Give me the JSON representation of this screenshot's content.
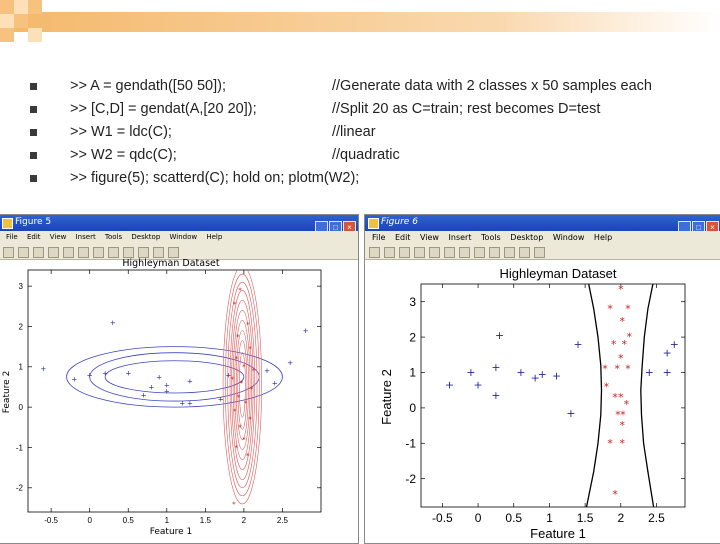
{
  "commands": [
    {
      "code": ">> A = gendath([50 50]);",
      "comment": "//Generate data with 2 classes x 50 samples each"
    },
    {
      "code": ">> [C,D] = gendat(A,[20 20]);",
      "comment": "//Split 20 as C=train; rest becomes D=test"
    },
    {
      "code": ">> W1 = ldc(C);",
      "comment": "//linear"
    },
    {
      "code": ">> W2 = qdc(C);",
      "comment": "//quadratic"
    },
    {
      "code": ">> figure(5); scatterd(C); hold on; plotm(W2);",
      "comment": ""
    }
  ],
  "colors": {
    "class1": "#22289a",
    "class2": "#c81e1e",
    "contour": "#e05a5a",
    "ellipse": "#3c45c0",
    "boundary": "#000000",
    "titlebar": "#1f4fc0"
  },
  "left_figure": {
    "window_title": "Figure 5",
    "menu": [
      "File",
      "Edit",
      "View",
      "Insert",
      "Tools",
      "Desktop",
      "Window",
      "Help"
    ],
    "toolbar_icons": [
      "new-icon",
      "open-icon",
      "save-icon",
      "print-icon",
      "pointer-icon",
      "zoom-in-icon",
      "zoom-out-icon",
      "pan-icon",
      "rotate-icon",
      "datacursor-icon",
      "colorbar-icon",
      "legend-icon"
    ]
  },
  "right_figure": {
    "window_title": "Figure 6",
    "menu": [
      "File",
      "Edit",
      "View",
      "Insert",
      "Tools",
      "Desktop",
      "Window",
      "Help"
    ],
    "toolbar_icons": [
      "new-icon",
      "open-icon",
      "save-icon",
      "print-icon",
      "pointer-icon",
      "zoom-in-icon",
      "zoom-out-icon",
      "pan-icon",
      "rotate-icon",
      "datacursor-icon",
      "colorbar-icon",
      "legend-icon"
    ]
  },
  "chart_data": [
    {
      "type": "scatter",
      "title": "Highleyman Dataset",
      "xlabel": "Feature 1",
      "ylabel": "Feature 2",
      "xlim": [
        -0.8,
        3.0
      ],
      "ylim": [
        -2.6,
        3.4
      ],
      "xticks": [
        -0.5,
        0,
        0.5,
        1,
        1.5,
        2,
        2.5
      ],
      "yticks": [
        -2,
        -1,
        0,
        1,
        2,
        3
      ],
      "xtick_labels": [
        "-0.5",
        "0",
        "0.5",
        "1",
        "1.5",
        "2",
        "2.5"
      ],
      "ytick_labels": [
        "-2",
        "-1",
        "0",
        "1",
        "2",
        "3"
      ],
      "series": [
        {
          "marker": "+",
          "color": "#22289a",
          "points": [
            [
              0.3,
              2.1
            ],
            [
              -0.6,
              0.95
            ],
            [
              2.8,
              1.9
            ],
            [
              2.6,
              1.1
            ],
            [
              0.9,
              0.75
            ],
            [
              0.8,
              0.5
            ],
            [
              1.7,
              0.2
            ],
            [
              0.5,
              0.85
            ],
            [
              2.3,
              0.9
            ],
            [
              -0.2,
              0.7
            ],
            [
              0.0,
              0.8
            ],
            [
              0.7,
              0.3
            ],
            [
              1.3,
              0.65
            ],
            [
              1.0,
              0.4
            ],
            [
              1.2,
              0.1
            ],
            [
              1.3,
              0.1
            ],
            [
              2.4,
              0.6
            ],
            [
              0.2,
              0.85
            ],
            [
              1.8,
              0.8
            ],
            [
              1.0,
              0.55
            ]
          ]
        },
        {
          "marker": "*",
          "color": "#c81e1e",
          "points": [
            [
              1.95,
              2.9
            ],
            [
              1.88,
              2.55
            ],
            [
              2.05,
              2.05
            ],
            [
              1.92,
              1.75
            ],
            [
              2.08,
              1.45
            ],
            [
              1.9,
              1.2
            ],
            [
              2.0,
              1.0
            ],
            [
              2.12,
              0.9
            ],
            [
              1.85,
              0.7
            ],
            [
              1.97,
              0.6
            ],
            [
              2.1,
              0.45
            ],
            [
              1.93,
              0.25
            ],
            [
              2.02,
              0.1
            ],
            [
              1.88,
              -0.1
            ],
            [
              2.08,
              -0.3
            ],
            [
              1.95,
              -0.5
            ],
            [
              2.0,
              -0.8
            ],
            [
              1.9,
              -1.0
            ],
            [
              2.05,
              -1.2
            ],
            [
              1.87,
              -2.4
            ]
          ]
        }
      ],
      "ellipse_center": [
        1.1,
        0.75
      ],
      "ellipse_semi_axes": [
        [
          1.4,
          0.75
        ],
        [
          1.1,
          0.6
        ],
        [
          0.9,
          0.4
        ]
      ],
      "contour_center": [
        1.98,
        0.55
      ],
      "contour_semi_axes": [
        [
          0.04,
          0.8
        ],
        [
          0.06,
          1.1
        ],
        [
          0.08,
          1.35
        ],
        [
          0.1,
          1.6
        ],
        [
          0.12,
          1.85
        ],
        [
          0.14,
          2.1
        ],
        [
          0.16,
          2.35
        ],
        [
          0.19,
          2.55
        ],
        [
          0.22,
          2.75
        ],
        [
          0.25,
          2.95
        ]
      ]
    },
    {
      "type": "scatter",
      "title": "Highleyman Dataset",
      "xlabel": "Feature 1",
      "ylabel": "Feature 2",
      "xlim": [
        -0.8,
        2.9
      ],
      "ylim": [
        -2.8,
        3.5
      ],
      "xticks": [
        -0.5,
        0,
        0.5,
        1,
        1.5,
        2,
        2.5
      ],
      "yticks": [
        -2,
        -1,
        0,
        1,
        2,
        3
      ],
      "xtick_labels": [
        "-0.5",
        "0",
        "0.5",
        "1",
        "1.5",
        "2",
        "2.5"
      ],
      "ytick_labels": [
        "-2",
        "-1",
        "0",
        "1",
        "2",
        "3"
      ],
      "series": [
        {
          "marker": "+",
          "color": "#22289a",
          "points": [
            [
              0.3,
              2.05
            ],
            [
              -0.4,
              0.65
            ],
            [
              0.0,
              0.65
            ],
            [
              1.4,
              1.8
            ],
            [
              0.9,
              0.95
            ],
            [
              2.75,
              1.8
            ],
            [
              2.65,
              1.55
            ],
            [
              2.65,
              1.0
            ],
            [
              2.4,
              1.0
            ],
            [
              1.1,
              0.9
            ],
            [
              -0.1,
              1.0
            ],
            [
              0.6,
              1.0
            ],
            [
              0.25,
              0.35
            ],
            [
              0.8,
              0.85
            ],
            [
              1.3,
              -0.15
            ],
            [
              0.25,
              1.15
            ]
          ]
        },
        {
          "marker": "*",
          "color": "#c81e1e",
          "points": [
            [
              2.0,
              3.35
            ],
            [
              2.1,
              2.8
            ],
            [
              1.85,
              2.8
            ],
            [
              2.02,
              2.45
            ],
            [
              2.12,
              2.0
            ],
            [
              2.05,
              1.8
            ],
            [
              1.9,
              1.8
            ],
            [
              2.0,
              1.4
            ],
            [
              1.95,
              1.1
            ],
            [
              2.1,
              1.1
            ],
            [
              1.78,
              1.1
            ],
            [
              1.8,
              0.6
            ],
            [
              2.0,
              0.3
            ],
            [
              1.92,
              0.3
            ],
            [
              2.08,
              0.1
            ],
            [
              1.96,
              -0.2
            ],
            [
              2.03,
              -0.2
            ],
            [
              2.02,
              -0.5
            ],
            [
              1.85,
              -1.0
            ],
            [
              2.02,
              -1.0
            ],
            [
              1.92,
              -2.45
            ]
          ]
        }
      ],
      "boundary_left": [
        [
          1.55,
          3.5
        ],
        [
          1.62,
          2.8
        ],
        [
          1.68,
          2.0
        ],
        [
          1.72,
          1.2
        ],
        [
          1.73,
          0.5
        ],
        [
          1.72,
          -0.2
        ],
        [
          1.68,
          -1.0
        ],
        [
          1.62,
          -1.8
        ],
        [
          1.52,
          -2.8
        ]
      ],
      "boundary_right": [
        [
          2.45,
          3.5
        ],
        [
          2.38,
          2.8
        ],
        [
          2.33,
          2.0
        ],
        [
          2.3,
          1.2
        ],
        [
          2.28,
          0.5
        ],
        [
          2.29,
          -0.2
        ],
        [
          2.32,
          -1.0
        ],
        [
          2.38,
          -1.8
        ],
        [
          2.46,
          -2.8
        ]
      ]
    }
  ]
}
